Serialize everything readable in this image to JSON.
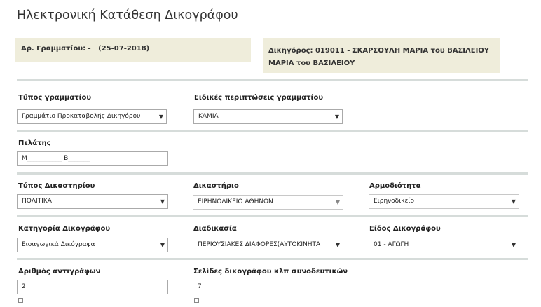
{
  "page": {
    "title": "Ηλεκτρονική Κατάθεση Δικογράφου"
  },
  "info": {
    "receipt": "Αρ. Γραμματίου: -   (25-07-2018)",
    "lawyer_line1": "Δικηγόρος: 019011 - ΣΚΑΡΣΟΥΛΗ ΜΑΡΙΑ του ΒΑΣΙΛΕΙΟΥ",
    "lawyer_line2": "ΜΑΡΙΑ του ΒΑΣΙΛΕΙΟΥ"
  },
  "form": {
    "receipt_type": {
      "label": "Τύπος γραμματίου",
      "value": "Γραμμάτιο Προκαταβολής Δικηγόρου"
    },
    "special_cases": {
      "label": "Ειδικές περιπτώσεις γραμματίου",
      "value": "ΚΑΜΙΑ"
    },
    "client": {
      "label": "Πελάτης",
      "value": "Μ___________ Β_______"
    },
    "court_type": {
      "label": "Τύπος Δικαστηρίου",
      "value": "ΠΟΛΙΤΙΚΑ"
    },
    "court": {
      "label": "Δικαστήριο",
      "value": "ΕΙΡΗΝΟΔΙΚΕΙΟ ΑΘΗΝΩΝ"
    },
    "jurisdiction": {
      "label": "Αρμοδιότητα",
      "value": "Ειρηνοδικείο"
    },
    "document_category": {
      "label": "Κατηγορία Δικογράφου",
      "value": "Εισαγωγικά Δικόγραφα"
    },
    "procedure": {
      "label": "Διαδικασία",
      "value": "ΠΕΡΙΟΥΣΙΑΚΕΣ ΔΙΑΦΟΡΕΣ(ΑΥΤΟΚΙΝΗΤΑ"
    },
    "document_kind": {
      "label": "Είδος Δικογράφου",
      "value": "01 - ΑΓΩΓΗ"
    },
    "copies": {
      "label": "Αριθμός αντιγράφων",
      "value": "2"
    },
    "pages": {
      "label": "Σελίδες δικογράφου κλπ συνοδευτικών",
      "value": "7"
    }
  },
  "icons": {
    "dropdown": "chevron-down-icon"
  }
}
